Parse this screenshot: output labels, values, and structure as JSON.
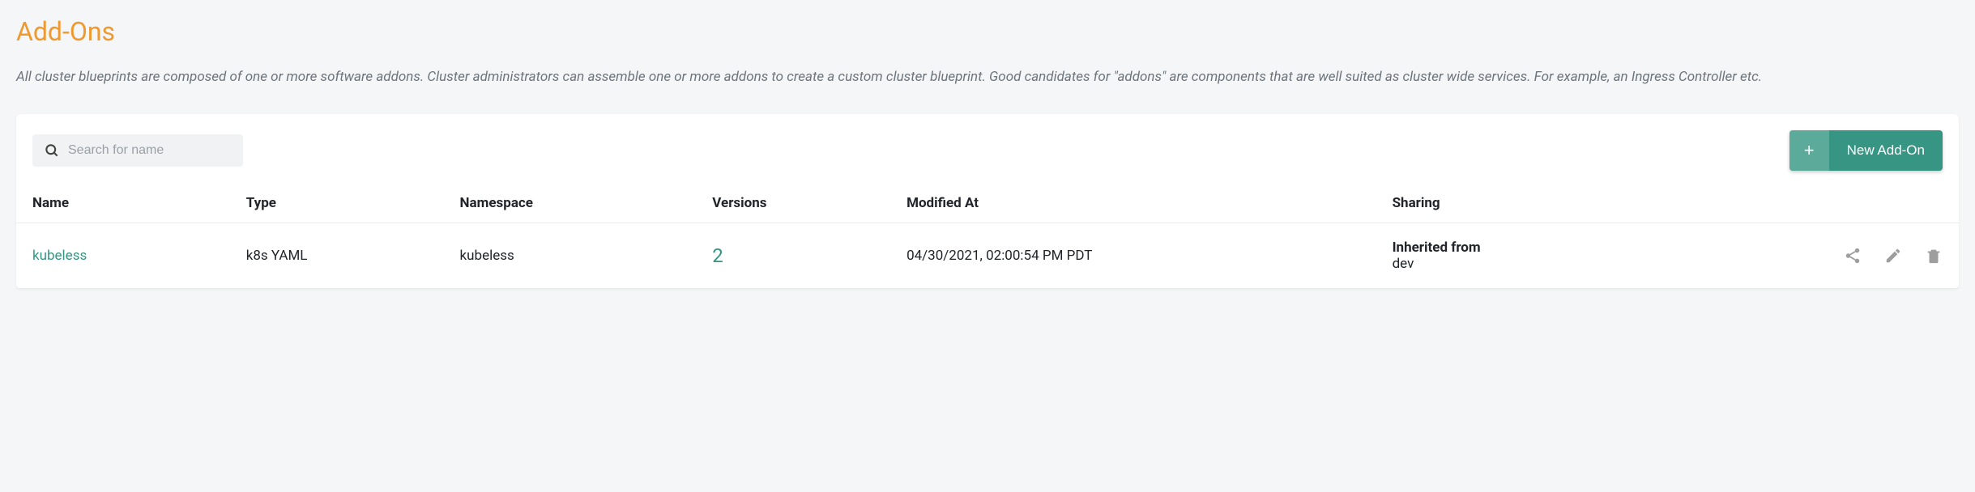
{
  "title": "Add-Ons",
  "description": "All cluster blueprints are composed of one or more software addons. Cluster administrators can assemble one or more addons to create a custom cluster blueprint. Good candidates for \"addons\" are components that are well suited as cluster wide services. For example, an Ingress Controller etc.",
  "search": {
    "placeholder": "Search for name"
  },
  "buttons": {
    "new_addon": "New Add-On",
    "plus": "+"
  },
  "table": {
    "headers": {
      "name": "Name",
      "type": "Type",
      "namespace": "Namespace",
      "versions": "Versions",
      "modified_at": "Modified At",
      "sharing": "Sharing"
    },
    "rows": [
      {
        "name": "kubeless",
        "type": "k8s YAML",
        "namespace": "kubeless",
        "versions": "2",
        "modified_at": "04/30/2021, 02:00:54 PM PDT",
        "sharing_primary": "Inherited from",
        "sharing_secondary": "dev"
      }
    ]
  }
}
